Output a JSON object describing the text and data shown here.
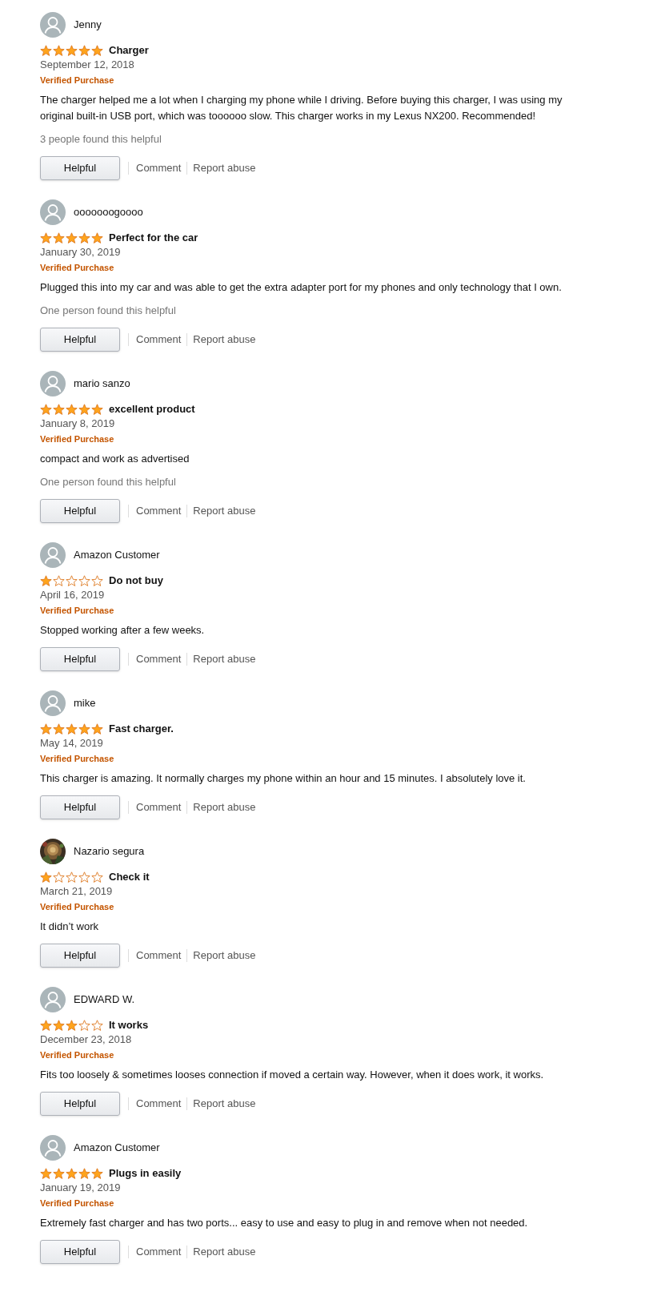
{
  "reviews": [
    {
      "avatar": {
        "kind": "default"
      },
      "name": "Jenny",
      "stars": 5,
      "title": "Charger",
      "date": "September 12, 2018",
      "badge": "Verified Purchase",
      "body": "The charger helped me a lot when I charging my phone while I driving. Before buying this charger, I was using my original built-in USB port, which was toooooo slow. This charger works in my Lexus NX200. Recommended!",
      "helpful_count": "3 people found this helpful",
      "buttons": {
        "helpful": "Helpful",
        "comment": "Comment",
        "report": "Report abuse"
      }
    },
    {
      "avatar": {
        "kind": "default"
      },
      "name": "ooooooogoooo",
      "stars": 5,
      "title": "Perfect for the car",
      "date": "January 30, 2019",
      "badge": "Verified Purchase",
      "body": "Plugged this into my car and was able to get the extra adapter port for my phones and only technology that I own.",
      "helpful_count": "One person found this helpful",
      "buttons": {
        "helpful": "Helpful",
        "comment": "Comment",
        "report": "Report abuse"
      }
    },
    {
      "avatar": {
        "kind": "default"
      },
      "name": "mario sanzo",
      "stars": 5,
      "title": "excellent product",
      "date": "January 8, 2019",
      "badge": "Verified Purchase",
      "body": "compact and work as advertised",
      "helpful_count": "One person found this helpful",
      "buttons": {
        "helpful": "Helpful",
        "comment": "Comment",
        "report": "Report abuse"
      }
    },
    {
      "avatar": {
        "kind": "default"
      },
      "name": "Amazon Customer",
      "stars": 1,
      "title": "Do not buy",
      "date": "April 16, 2019",
      "badge": "Verified Purchase",
      "body": "Stopped working after a few weeks.",
      "buttons": {
        "helpful": "Helpful",
        "comment": "Comment",
        "report": "Report abuse"
      }
    },
    {
      "avatar": {
        "kind": "default"
      },
      "name": "mike",
      "stars": 5,
      "title": "Fast charger.",
      "date": "May 14, 2019",
      "badge": "Verified Purchase",
      "body": "This charger is amazing. It normally charges my phone within an hour and 15 minutes. I absolutely love it.",
      "buttons": {
        "helpful": "Helpful",
        "comment": "Comment",
        "report": "Report abuse"
      }
    },
    {
      "name": "Nazario segura",
      "stars": 1,
      "title": "Check it",
      "date": "March 21, 2019",
      "badge": "Verified Purchase",
      "body": "It didn’t work",
      "buttons": {
        "helpful": "Helpful",
        "comment": "Comment",
        "report": "Report abuse"
      }
    },
    {
      "avatar": {
        "kind": "default"
      },
      "name": "EDWARD W.",
      "stars": 3,
      "title": "It works",
      "date": "December 23, 2018",
      "badge": "Verified Purchase",
      "body": "Fits too loosely & sometimes looses connection if moved a certain way. However, when it does work, it works.",
      "buttons": {
        "helpful": "Helpful",
        "comment": "Comment",
        "report": "Report abuse"
      }
    },
    {
      "avatar": {
        "kind": "default"
      },
      "name": "Amazon Customer",
      "stars": 5,
      "title": "Plugs in easily",
      "date": "January 19, 2019",
      "badge": "Verified Purchase",
      "body": "Extremely fast charger and has two ports... easy to use and easy to plug in and remove when not needed.",
      "buttons": {
        "helpful": "Helpful",
        "comment": "Comment",
        "report": "Report abuse"
      }
    }
  ]
}
